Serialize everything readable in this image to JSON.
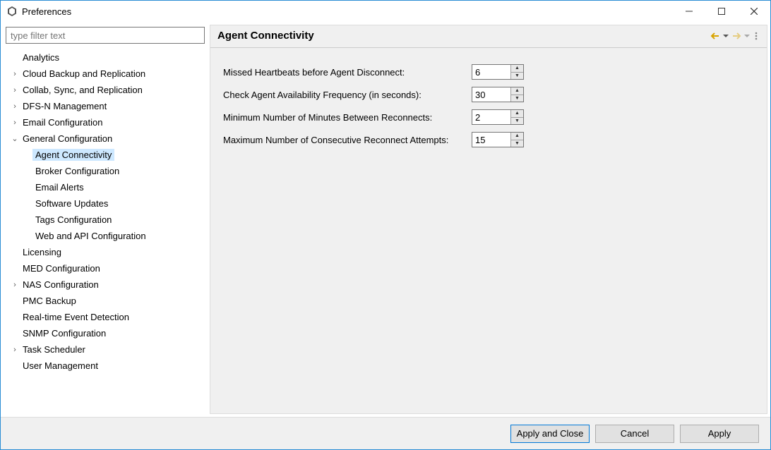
{
  "window": {
    "title": "Preferences"
  },
  "filter": {
    "placeholder": "type filter text"
  },
  "tree": {
    "analytics": "Analytics",
    "cloud_backup": "Cloud Backup and Replication",
    "collab": "Collab, Sync, and Replication",
    "dfsn": "DFS-N Management",
    "email_config": "Email Configuration",
    "general_config": "General Configuration",
    "agent_conn": "Agent Connectivity",
    "broker_config": "Broker Configuration",
    "email_alerts": "Email Alerts",
    "software_updates": "Software Updates",
    "tags_config": "Tags Configuration",
    "web_api": "Web and API Configuration",
    "licensing": "Licensing",
    "med_config": "MED Configuration",
    "nas_config": "NAS Configuration",
    "pmc_backup": "PMC Backup",
    "rted": "Real-time Event Detection",
    "snmp": "SNMP Configuration",
    "task_sched": "Task Scheduler",
    "user_mgmt": "User Management"
  },
  "page": {
    "title": "Agent Connectivity",
    "fields": {
      "missed_hb": {
        "label": "Missed Heartbeats before Agent Disconnect:",
        "value": "6"
      },
      "check_freq": {
        "label": "Check Agent Availability Frequency (in seconds):",
        "value": "30"
      },
      "min_reconnect": {
        "label": "Minimum Number of Minutes Between Reconnects:",
        "value": "2"
      },
      "max_attempts": {
        "label": "Maximum Number of Consecutive Reconnect Attempts:",
        "value": "15"
      }
    }
  },
  "buttons": {
    "apply_close": "Apply and Close",
    "cancel": "Cancel",
    "apply": "Apply"
  }
}
